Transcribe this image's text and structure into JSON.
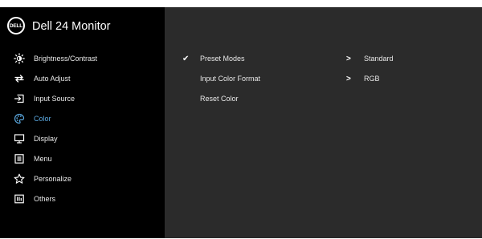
{
  "header": {
    "brand_logo": "DELL",
    "title": "Dell 24 Monitor"
  },
  "menu": {
    "items": [
      {
        "label": "Brightness/Contrast",
        "icon": "brightness-icon"
      },
      {
        "label": "Auto Adjust",
        "icon": "auto-adjust-icon"
      },
      {
        "label": "Input Source",
        "icon": "input-source-icon"
      },
      {
        "label": "Color",
        "icon": "color-palette-icon",
        "active": true
      },
      {
        "label": "Display",
        "icon": "display-icon"
      },
      {
        "label": "Menu",
        "icon": "menu-icon"
      },
      {
        "label": "Personalize",
        "icon": "star-icon"
      },
      {
        "label": "Others",
        "icon": "others-icon"
      }
    ]
  },
  "color_panel": {
    "rows": [
      {
        "label": "Preset Modes",
        "value": "Standard",
        "selected": true
      },
      {
        "label": "Input Color Format",
        "value": "RGB"
      },
      {
        "label": "Reset Color",
        "value": ""
      }
    ]
  },
  "colors": {
    "active_accent": "#5aa7de",
    "right_panel_bg": "#2b2b2b",
    "left_panel_bg": "#000000"
  }
}
